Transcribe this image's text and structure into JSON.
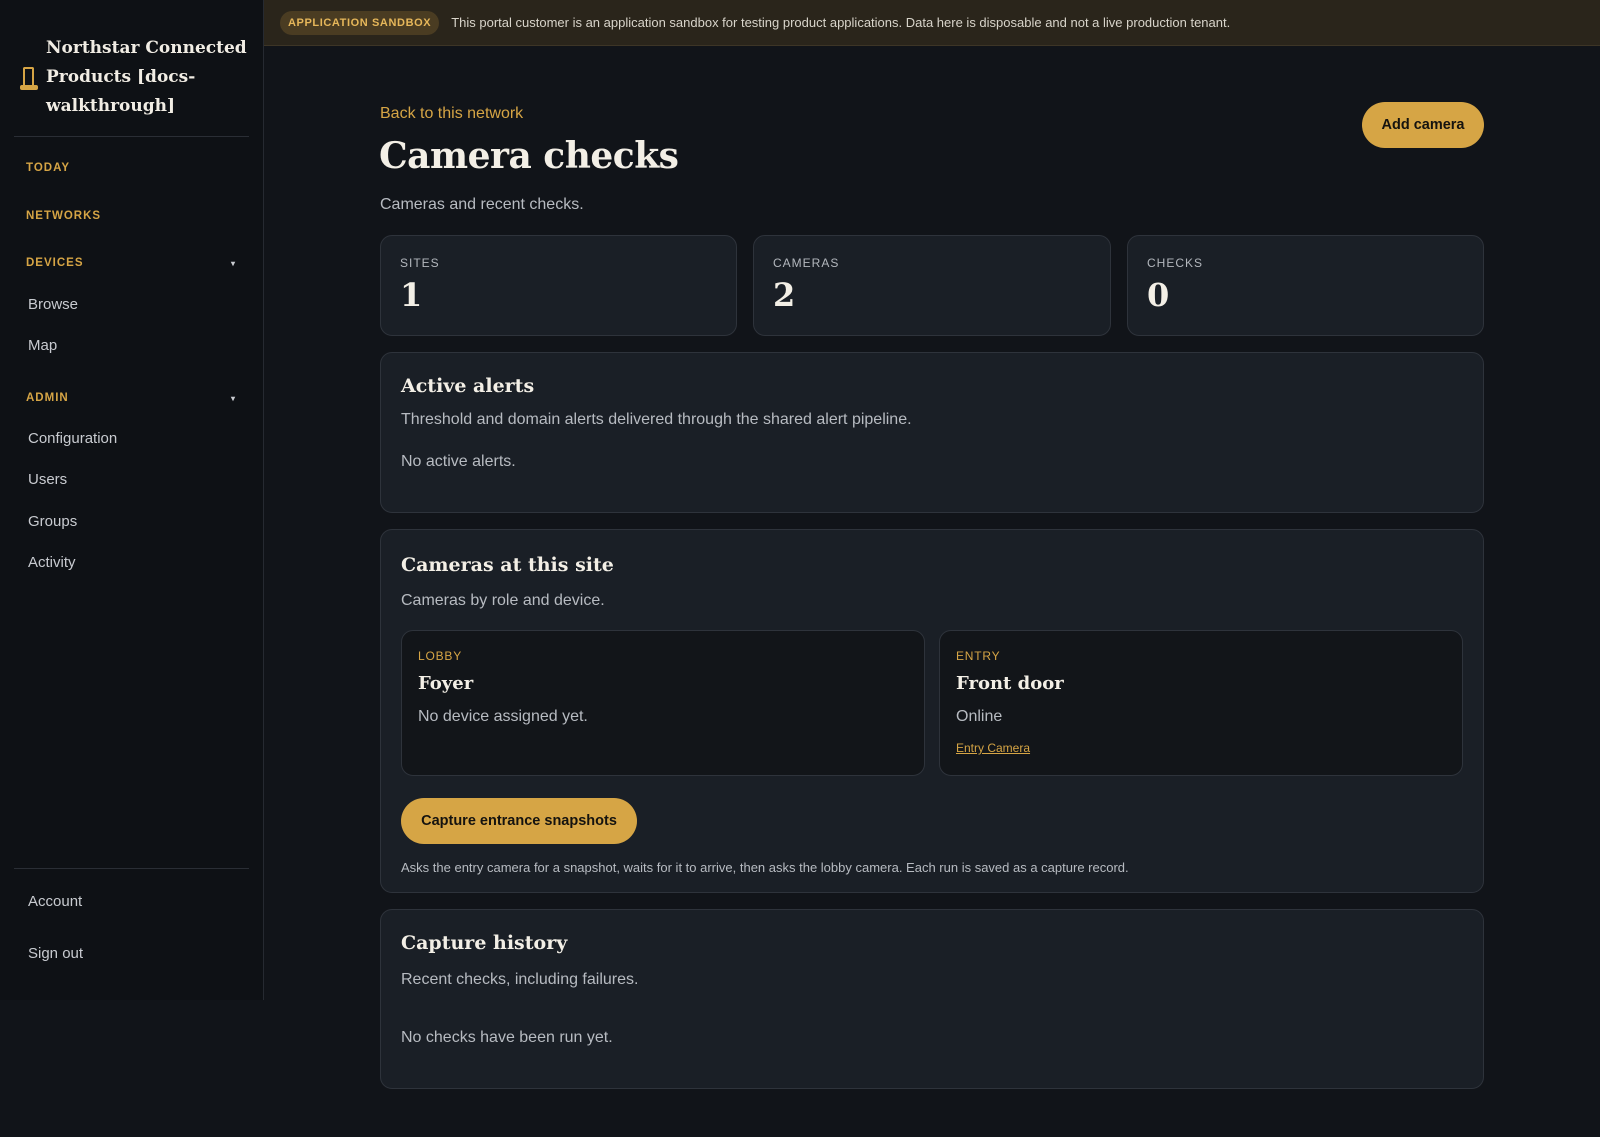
{
  "brand": {
    "name": "Northstar Connected Products [docs-walkthrough]",
    "icon": "beacon-icon"
  },
  "sidebar": {
    "today": "TODAY",
    "networks": "NETWORKS",
    "devices": {
      "label": "DEVICES",
      "caret": "▾",
      "items": [
        "Browse",
        "Map"
      ]
    },
    "admin": {
      "label": "ADMIN",
      "caret": "▾",
      "items": [
        "Configuration",
        "Users",
        "Groups",
        "Activity"
      ]
    },
    "footer": [
      "Account",
      "Sign out"
    ]
  },
  "banner": {
    "badge": "APPLICATION SANDBOX",
    "text": "This portal customer is an application sandbox for testing product applications. Data here is disposable and not a live production tenant."
  },
  "header": {
    "back": "Back to this network",
    "title": "Camera checks",
    "subtitle": "Cameras and recent checks.",
    "add_button": "Add camera"
  },
  "stats": [
    {
      "label": "SITES",
      "value": "1"
    },
    {
      "label": "CAMERAS",
      "value": "2"
    },
    {
      "label": "CHECKS",
      "value": "0"
    }
  ],
  "alerts": {
    "title": "Active alerts",
    "desc": "Threshold and domain alerts delivered through the shared alert pipeline.",
    "empty": "No active alerts."
  },
  "cameras": {
    "title": "Cameras at this site",
    "desc": "Cameras by role and device.",
    "items": [
      {
        "role": "LOBBY",
        "name": "Foyer",
        "status": "No device assigned yet.",
        "link": ""
      },
      {
        "role": "ENTRY",
        "name": "Front door",
        "status": "Online",
        "link": "Entry Camera"
      }
    ],
    "capture_button": "Capture entrance snapshots",
    "capture_note": "Asks the entry camera for a snapshot, waits for it to arrive, then asks the lobby camera. Each run is saved as a capture record."
  },
  "history": {
    "title": "Capture history",
    "desc": "Recent checks, including failures.",
    "empty": "No checks have been run yet."
  },
  "colors": {
    "accent": "#d6a545",
    "background": "#111419",
    "card": "#1a1f26",
    "sidebar": "#0e1115"
  }
}
